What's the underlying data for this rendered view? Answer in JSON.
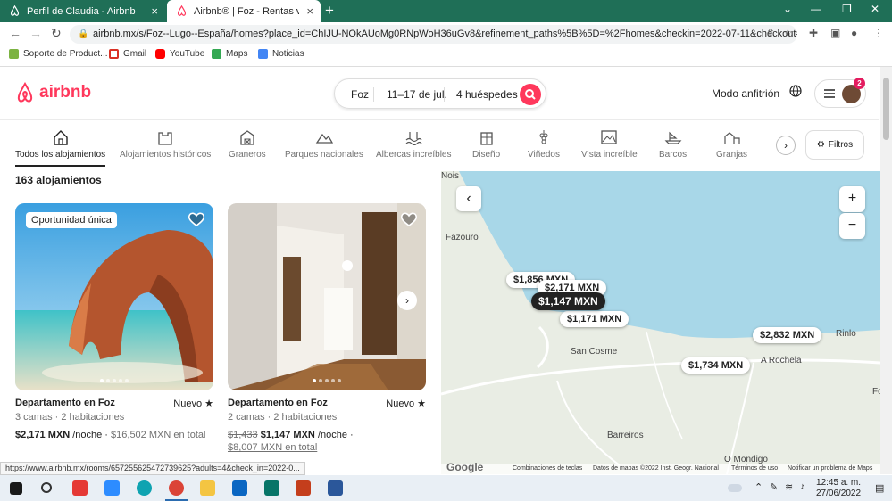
{
  "browser": {
    "tabs": [
      {
        "title": "Perfil de Claudia - Airbnb"
      },
      {
        "title": "Airbnb® | Foz - Rentas vacacionales"
      }
    ],
    "url": "airbnb.mx/s/Foz--Lugo--España/homes?place_id=ChIJU-NOkAUoMg0RNpWoH36uGv8&refinement_paths%5B%5D=%2Fhomes&checkin=2022-07-11&checkout=...",
    "bookmarks": [
      "Soporte de Product...",
      "Gmail",
      "YouTube",
      "Maps",
      "Noticias"
    ]
  },
  "header": {
    "logo": "airbnb",
    "search": {
      "location": "Foz",
      "dates": "11–17 de jul.",
      "guests": "4 huéspedes"
    },
    "host_link": "Modo anfitrión",
    "notification_count": "2"
  },
  "categories": [
    "Todos los alojamientos",
    "Alojamientos históricos",
    "Graneros",
    "Parques nacionales",
    "Albercas increíbles",
    "Diseño",
    "Viñedos",
    "Vista increíble",
    "Barcos",
    "Granjas"
  ],
  "filters_label": "Filtros",
  "results_count": "163 alojamientos",
  "listings": [
    {
      "badge": "Oportunidad única",
      "title": "Departamento en Foz",
      "rating": "",
      "details": "3 camas · 2 habitaciones",
      "price": "$2,171 MXN",
      "per_night": "/noche ·",
      "total": "$16,502 MXN en total"
    },
    {
      "title": "Departamento en Foz",
      "rating": "Nuevo ★",
      "details": "2 camas · 2 habitaciones",
      "old_price": "$1,433",
      "price": "$1,147 MXN",
      "per_night": "/noche ·",
      "total": "$8,007 MXN en total"
    }
  ],
  "listing1_rating": "Nuevo ★",
  "map": {
    "pins": [
      "$1,856 MXN",
      "$2,171 MXN",
      "$1,147 MXN",
      "$1,171 MXN",
      "$2,832 MXN",
      "$1,734 MXN"
    ],
    "places": [
      "Nois",
      "Fazouro",
      "San Cosme",
      "A Rochela",
      "Rinlo",
      "Barreiros",
      "O Mondigo",
      "Fo"
    ],
    "footer": [
      "Combinaciones de teclas",
      "Datos de mapas ©2022 Inst. Geogr. Nacional",
      "Términos de uso",
      "Notificar un problema de Maps"
    ],
    "google": "Google"
  },
  "status_url": "https://www.airbnb.mx/rooms/657255625472739625?adults=4&check_in=2022-0...",
  "clock": {
    "time": "12:45 a. m.",
    "date": "27/06/2022"
  }
}
